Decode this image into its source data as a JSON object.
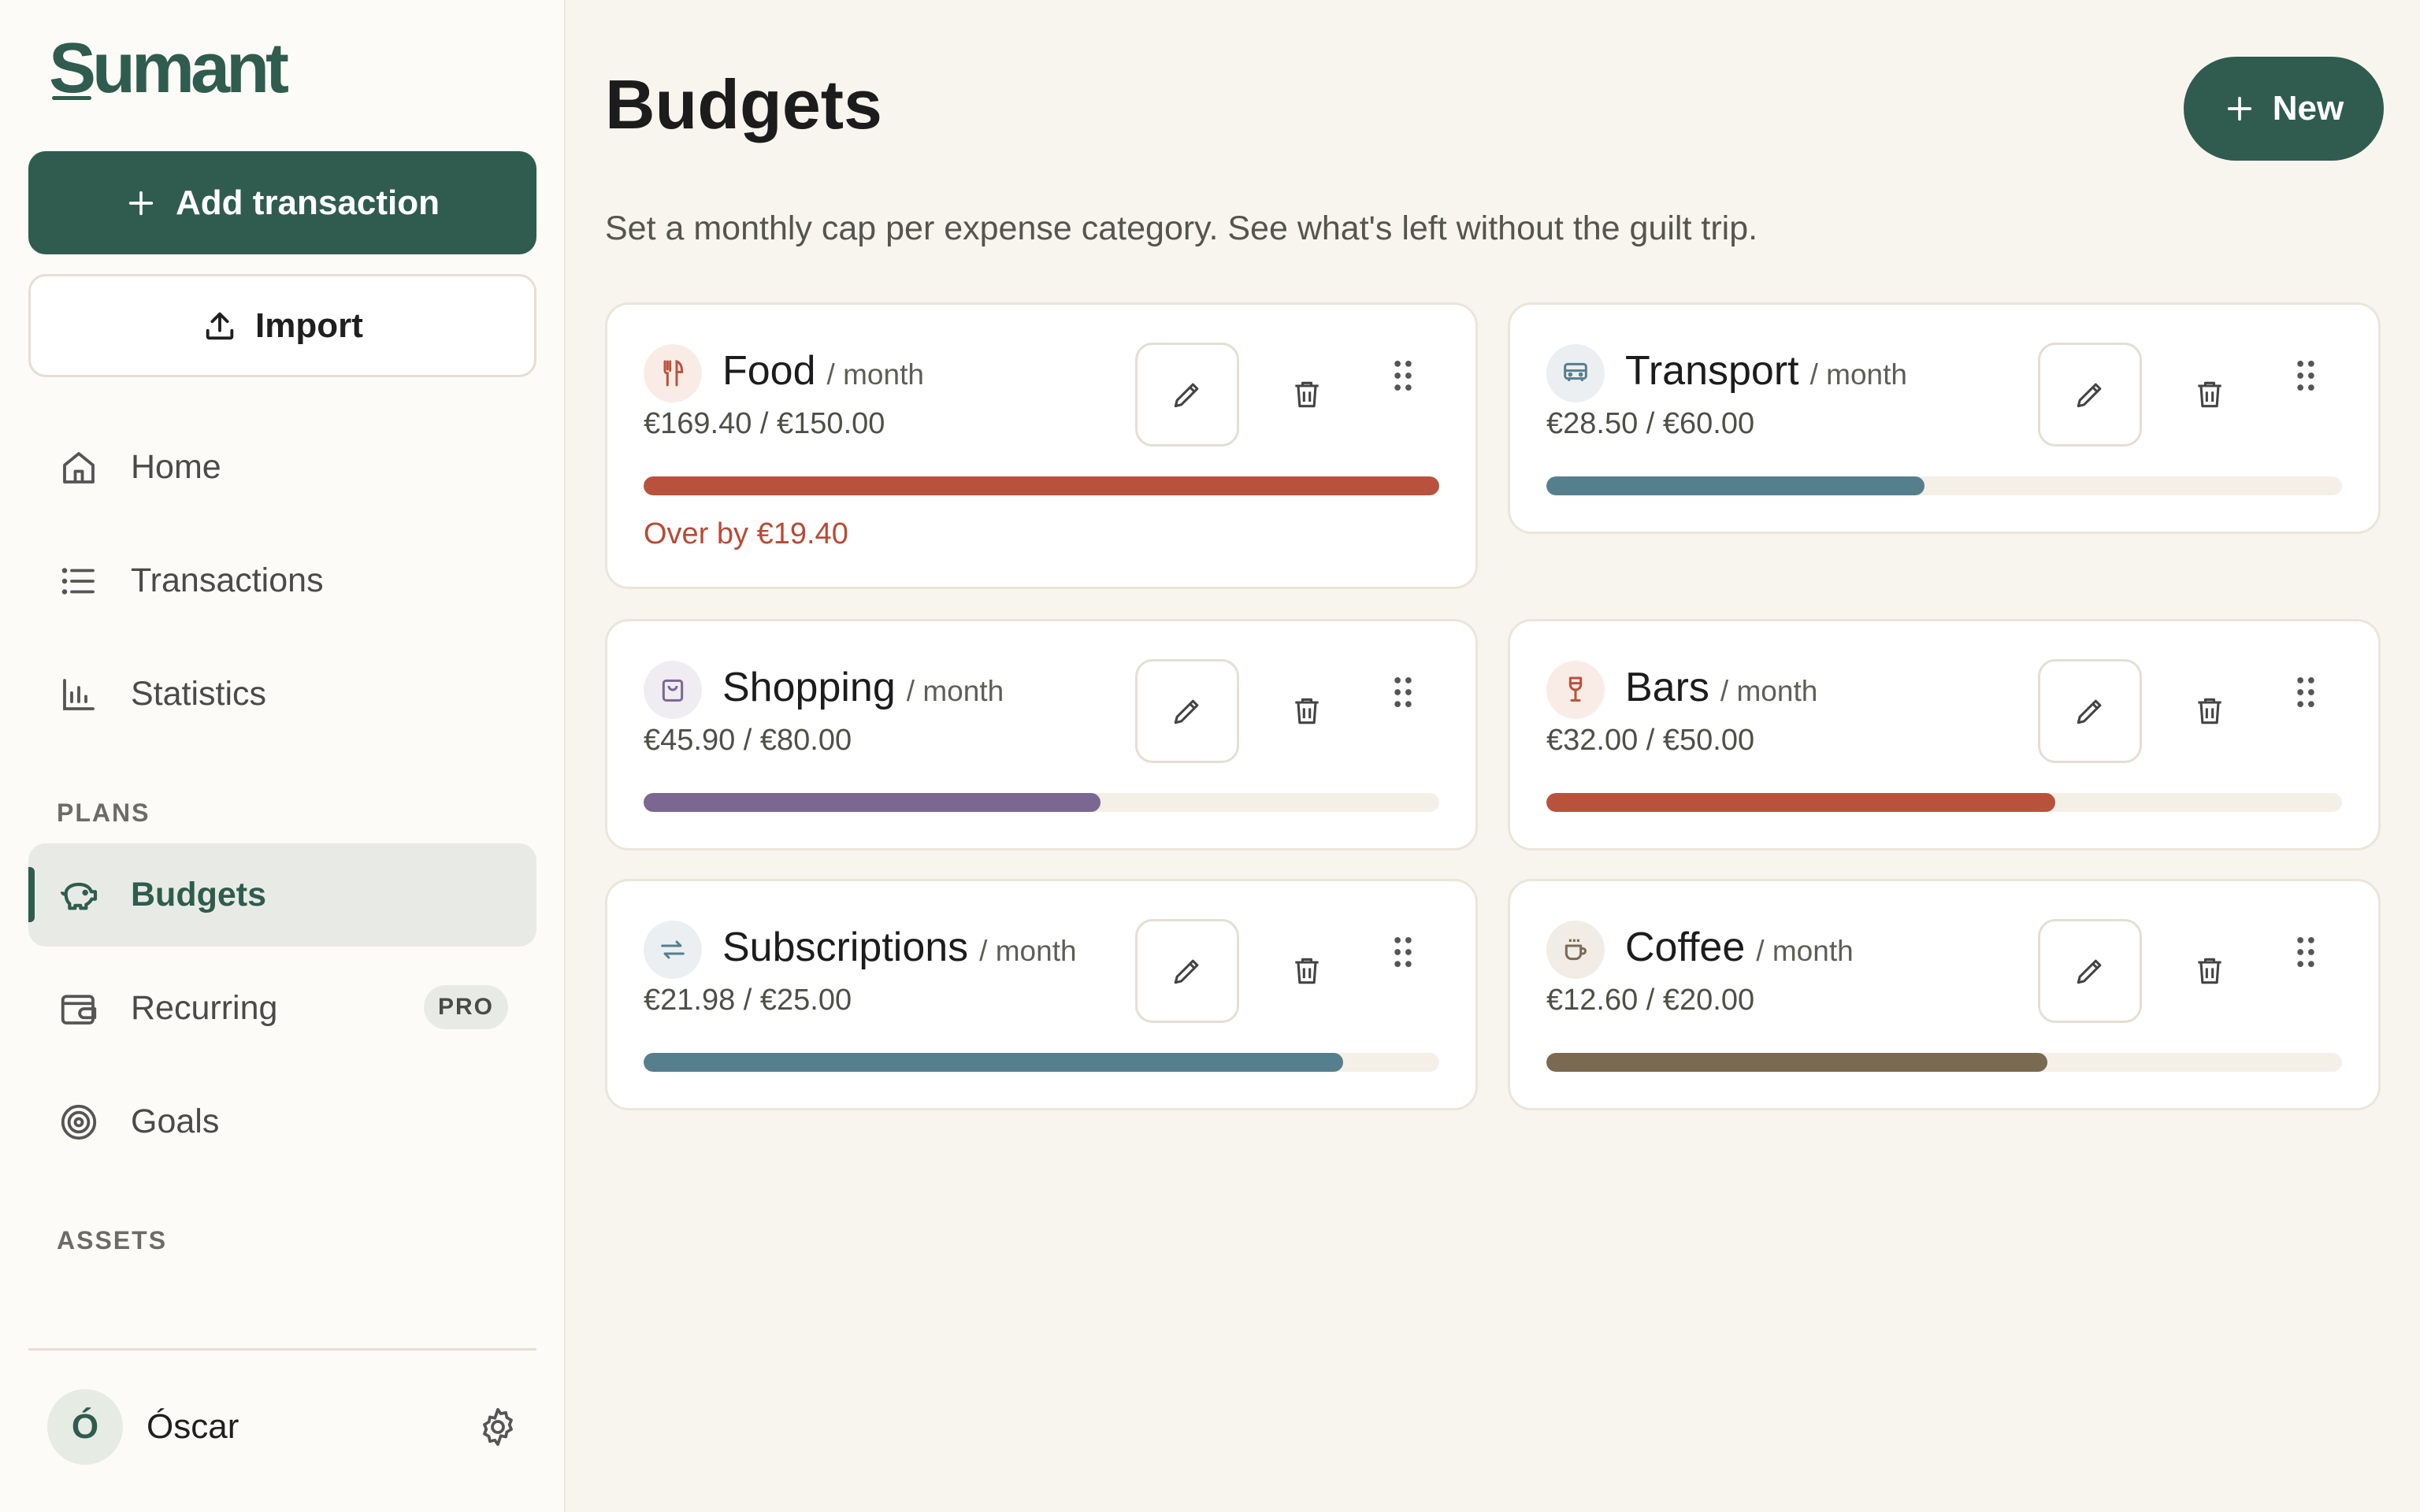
{
  "app": {
    "logo": "Sumant"
  },
  "sidebar": {
    "add_label": "Add transaction",
    "import_label": "Import",
    "nav": [
      {
        "label": "Home",
        "icon": "home-icon"
      },
      {
        "label": "Transactions",
        "icon": "list-icon"
      },
      {
        "label": "Statistics",
        "icon": "bar-chart-icon"
      }
    ],
    "plans_heading": "PLANS",
    "plans": [
      {
        "label": "Budgets",
        "icon": "piggy-bank-icon",
        "active": true
      },
      {
        "label": "Recurring",
        "icon": "wallet-icon",
        "badge": "PRO"
      },
      {
        "label": "Goals",
        "icon": "target-icon"
      }
    ],
    "assets_heading": "ASSETS",
    "user": {
      "initial": "Ó",
      "name": "Óscar"
    }
  },
  "main": {
    "title": "Budgets",
    "new_label": "New",
    "subtitle": "Set a monthly cap per expense category. See what's left without the guilt trip.",
    "period_label": "/ month",
    "budgets": [
      {
        "name": "Food",
        "icon": "utensils-icon",
        "amount": "€169.40 / €150.00",
        "progress": 1.0,
        "color": "#b9523c",
        "over_text": "Over by €19.40"
      },
      {
        "name": "Transport",
        "icon": "bus-icon",
        "amount": "€28.50 / €60.00",
        "progress": 0.475,
        "color": "#567f8d"
      },
      {
        "name": "Shopping",
        "icon": "shopping-bag-icon",
        "amount": "€45.90 / €80.00",
        "progress": 0.574,
        "color": "#7b6791"
      },
      {
        "name": "Bars",
        "icon": "wine-glass-icon",
        "amount": "€32.00 / €50.00",
        "progress": 0.64,
        "color": "#b9523c"
      },
      {
        "name": "Subscriptions",
        "icon": "repeat-icon",
        "amount": "€21.98 / €25.00",
        "progress": 0.879,
        "color": "#567f8d"
      },
      {
        "name": "Coffee",
        "icon": "coffee-cup-icon",
        "amount": "€12.60 / €20.00",
        "progress": 0.63,
        "color": "#7a6a52"
      }
    ]
  }
}
